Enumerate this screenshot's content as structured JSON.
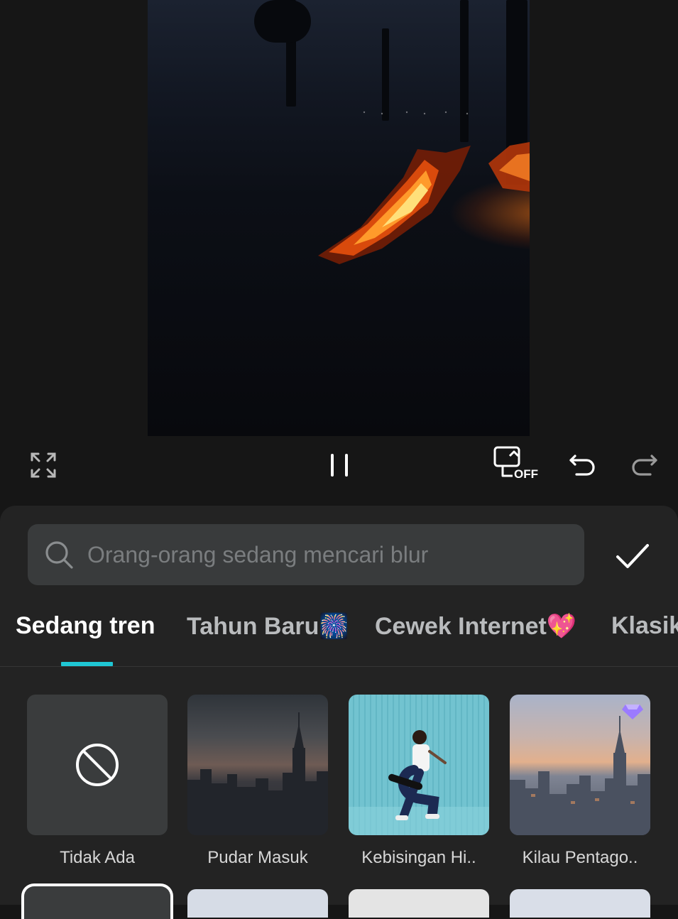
{
  "toolbar": {
    "fullscreen_icon": "fullscreen-icon",
    "pause_icon": "pause-icon",
    "keyframe_off_label": "OFF",
    "undo_icon": "undo-icon",
    "redo_icon": "redo-icon"
  },
  "search": {
    "placeholder": "Orang-orang sedang mencari blur",
    "value": ""
  },
  "tabs": [
    {
      "label": "Sedang tren",
      "active": true
    },
    {
      "label": "Tahun Baru🎆",
      "active": false
    },
    {
      "label": "Cewek Internet💖",
      "active": false
    },
    {
      "label": "Klasik",
      "active": false
    }
  ],
  "effects": [
    {
      "label": "Tidak Ada",
      "premium": false
    },
    {
      "label": "Pudar Masuk",
      "premium": false
    },
    {
      "label": "Kebisingan Hi..",
      "premium": false
    },
    {
      "label": "Kilau Pentago..",
      "premium": true
    }
  ],
  "colors": {
    "accent": "#1fc7d4",
    "panel": "#232323",
    "background": "#161616",
    "premium": "#9b7bff"
  }
}
